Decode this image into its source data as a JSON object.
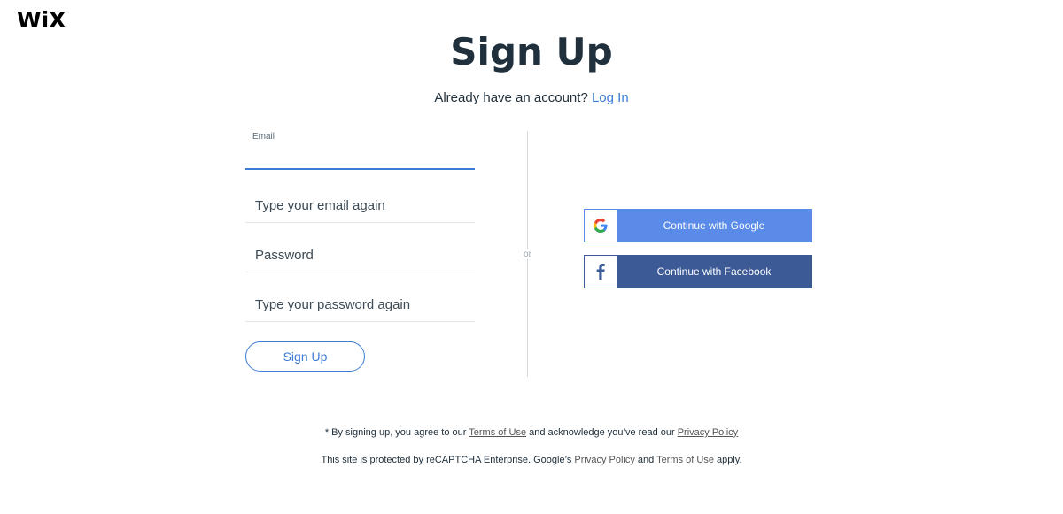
{
  "brand": {
    "logo_text": "WiX"
  },
  "header": {
    "title": "Sign Up",
    "subtitle_prefix": "Already have an account?",
    "login_link": "Log In"
  },
  "form": {
    "email_label": "Email",
    "email_value": "",
    "confirm_email_placeholder": "Type your email again",
    "password_placeholder": "Password",
    "confirm_password_placeholder": "Type your password again",
    "submit_label": "Sign Up"
  },
  "divider": {
    "text": "or"
  },
  "social": {
    "google_label": "Continue with Google",
    "facebook_label": "Continue with Facebook",
    "google_icon": "google-g-icon",
    "facebook_icon": "facebook-f-icon"
  },
  "footer": {
    "line1_prefix": "* By signing up, you agree to our ",
    "line1_terms": "Terms of Use",
    "line1_middle": " and acknowledge you’ve read our ",
    "line1_privacy": "Privacy Policy",
    "line2_prefix": "This site is protected by reCAPTCHA Enterprise. Google’s ",
    "line2_privacy": "Privacy Policy",
    "line2_middle": " and ",
    "line2_terms": "Terms of Use",
    "line2_suffix": " apply."
  },
  "colors": {
    "accent": "#3b7cd6",
    "google_blue": "#5a8be8",
    "facebook_blue": "#3c5a96",
    "text": "#20303c"
  }
}
